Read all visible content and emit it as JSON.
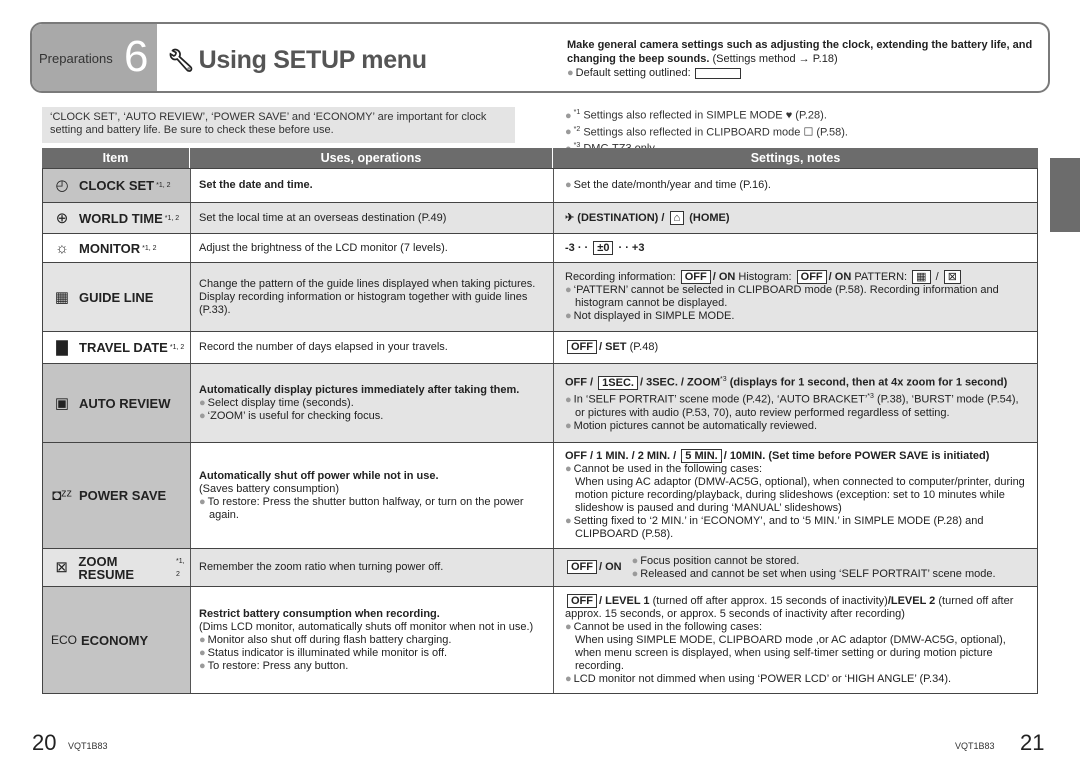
{
  "header": {
    "section": "Preparations",
    "chapter": "6",
    "title": "Using SETUP menu",
    "intro_bold": "Make general camera settings such as adjusting the clock, extending the battery life, and changing the beep sounds.",
    "intro_ref": "(Settings method → P.18)",
    "default_note": "Default setting outlined:"
  },
  "important": "‘CLOCK SET’, ‘AUTO REVIEW’, ‘POWER SAVE’ and ‘ECONOMY’ are important for clock setting and battery life. Be sure to check these before use.",
  "footnotes": [
    {
      "mark": "*1",
      "text": "Settings also reflected in SIMPLE MODE ♥ (P.28)."
    },
    {
      "mark": "*2",
      "text": "Settings also reflected in CLIPBOARD mode ☐ (P.58)."
    },
    {
      "mark": "*3",
      "text": "DMC-TZ3 only."
    }
  ],
  "columns": [
    "Item",
    "Uses, operations",
    "Settings, notes"
  ],
  "colors": {
    "header_bg": "#6c6c6c",
    "important_cell": "#c4c4c4",
    "shade": "#e4e4e4",
    "bullet": "#9a9a9a"
  },
  "rows": [
    {
      "name": "CLOCK SET",
      "sup": "*1, 2",
      "icon": "clock-icon",
      "glyph": "◴",
      "important": true,
      "shade": false,
      "uses": [
        {
          "text": "Set the date and time.",
          "bold": true
        }
      ],
      "notes": [
        {
          "bullet": true,
          "segs": [
            {
              "t": "Set the date/month/year and time (P.16)."
            }
          ]
        }
      ]
    },
    {
      "name": "WORLD TIME",
      "sup": "*1, 2",
      "icon": "globe-icon",
      "glyph": "⊕",
      "important": false,
      "shade": true,
      "uses": [
        {
          "text": "Set the local time at an overseas destination (P.49)"
        }
      ],
      "notes": [
        {
          "segs": [
            {
              "t": "✈",
              "b": true
            },
            {
              "t": " (DESTINATION) / ",
              "b": true
            },
            {
              "t": "⌂",
              "box": true
            },
            {
              "t": " (HOME)",
              "b": true
            }
          ]
        }
      ]
    },
    {
      "name": "MONITOR",
      "sup": "*1, 2",
      "icon": "brightness-icon",
      "glyph": "☼",
      "important": false,
      "shade": false,
      "uses": [
        {
          "text": "Adjust the brightness of the LCD monitor (7 levels)."
        }
      ],
      "notes": [
        {
          "segs": [
            {
              "t": "-3  ·  · ",
              "b": true
            },
            {
              "t": "±0",
              "box": true,
              "b": true
            },
            {
              "t": " ·  ·  +3",
              "b": true
            }
          ]
        }
      ]
    },
    {
      "name": "GUIDE LINE",
      "sup": "",
      "icon": "grid-icon",
      "glyph": "▦",
      "important": false,
      "shade": true,
      "uses": [
        {
          "text": "Change the pattern of the guide lines displayed when taking pictures."
        },
        {
          "text": "Display recording information or histogram together with guide lines (P.33)."
        }
      ],
      "notes": [
        {
          "segs": [
            {
              "t": "Recording information: "
            },
            {
              "t": "OFF",
              "box": true,
              "b": true
            },
            {
              "t": "/ ON",
              "b": true
            },
            {
              "t": "   Histogram: "
            },
            {
              "t": "OFF",
              "box": true,
              "b": true
            },
            {
              "t": "/ ON",
              "b": true
            },
            {
              "t": "   PATTERN: "
            },
            {
              "t": "▦",
              "box": true
            },
            {
              "t": " / "
            },
            {
              "t": "⊠",
              "box": true
            }
          ]
        },
        {
          "bullet": true,
          "segs": [
            {
              "t": "‘PATTERN’ cannot be selected in CLIPBOARD mode (P.58). Recording information and histogram cannot be displayed."
            }
          ]
        },
        {
          "bullet": true,
          "segs": [
            {
              "t": "Not displayed in SIMPLE MODE."
            }
          ]
        }
      ]
    },
    {
      "name": "TRAVEL DATE",
      "sup": "*1, 2",
      "icon": "suitcase-icon",
      "glyph": "▇",
      "important": false,
      "shade": false,
      "uses": [
        {
          "text": "Record the number of days elapsed in your travels."
        }
      ],
      "notes": [
        {
          "segs": [
            {
              "t": "OFF",
              "box": true,
              "b": true
            },
            {
              "t": "/ SET",
              "b": true
            },
            {
              "t": " (P.48)"
            }
          ]
        }
      ]
    },
    {
      "name": "AUTO REVIEW",
      "sup": "",
      "icon": "auto-review-icon",
      "glyph": "▣",
      "important": true,
      "shade": true,
      "uses": [
        {
          "text": "Automatically display pictures immediately after taking them.",
          "bold": true
        },
        {
          "text": "Select display time (seconds).",
          "bullet": true
        },
        {
          "text": "‘ZOOM’ is useful for checking focus.",
          "bullet": true
        }
      ],
      "notes": [
        {
          "segs": [
            {
              "t": "OFF / ",
              "b": true
            },
            {
              "t": "1SEC.",
              "box": true,
              "b": true
            },
            {
              "t": "/ 3SEC. / ZOOM",
              "b": true
            },
            {
              "t": "*3",
              "sup": true
            },
            {
              "t": " (displays for 1 second, then at 4x zoom for 1 second)",
              "b": true
            }
          ]
        },
        {
          "bullet": true,
          "segs": [
            {
              "t": "In ‘SELF PORTRAIT’ scene mode (P.42), ‘AUTO BRACKET’"
            },
            {
              "t": "*3",
              "sup": true
            },
            {
              "t": " (P.38), ‘BURST’ mode (P.54), or pictures with audio (P.53, 70), auto review performed regardless of setting."
            }
          ]
        },
        {
          "bullet": true,
          "segs": [
            {
              "t": "Motion pictures cannot be automatically reviewed."
            }
          ]
        }
      ]
    },
    {
      "name": "POWER SAVE",
      "sup": "",
      "icon": "power-save-icon",
      "glyph": "◘ᶻᶻ",
      "important": true,
      "shade": false,
      "uses": [
        {
          "text": "Automatically shut off power while not in use.",
          "bold": true
        },
        {
          "text": "(Saves battery consumption)"
        },
        {
          "text": "To restore: Press the shutter button halfway, or turn on the power again.",
          "bullet": true
        }
      ],
      "notes": [
        {
          "segs": [
            {
              "t": "OFF / 1 MIN. / 2 MIN. / ",
              "b": true
            },
            {
              "t": "5 MIN.",
              "box": true,
              "b": true
            },
            {
              "t": "/ 10MIN. (Set time before POWER SAVE is initiated)",
              "b": true
            }
          ]
        },
        {
          "bullet": true,
          "segs": [
            {
              "t": "Cannot be used in the following cases:"
            }
          ]
        },
        {
          "indent": true,
          "segs": [
            {
              "t": "When using AC adaptor (DMW-AC5G, optional), when connected to computer/printer, during motion picture recording/playback, during slideshows (exception: set to 10 minutes while slideshow is paused and during ‘MANUAL’ slideshows)"
            }
          ]
        },
        {
          "bullet": true,
          "segs": [
            {
              "t": "Setting fixed to ‘2 MIN.’ in ‘ECONOMY’, and to ‘5 MIN.’ in SIMPLE MODE (P.28) and CLIPBOARD (P.58)."
            }
          ]
        }
      ]
    },
    {
      "name": "ZOOM RESUME",
      "sup": "*1, 2",
      "icon": "zoom-resume-icon",
      "glyph": "⊠",
      "important": false,
      "shade": true,
      "inline": true,
      "uses": [
        {
          "text": "Remember the zoom ratio when turning power off."
        }
      ],
      "notes": [
        {
          "segs": [
            {
              "t": "OFF",
              "box": true,
              "b": true
            },
            {
              "t": "/ ON",
              "b": true
            }
          ]
        },
        {
          "bullet": true,
          "segs": [
            {
              "t": "Focus position cannot be stored."
            }
          ]
        },
        {
          "bullet": true,
          "segs": [
            {
              "t": "Released and cannot be set when using ‘SELF PORTRAIT’ scene mode."
            }
          ]
        }
      ]
    },
    {
      "name": "ECONOMY",
      "sup": "",
      "icon": "eco-icon",
      "glyph": "ECO",
      "important": true,
      "shade": false,
      "uses": [
        {
          "text": "Restrict battery consumption when recording.",
          "bold": true
        },
        {
          "text": "(Dims LCD monitor, automatically shuts off monitor when not in use.)"
        },
        {
          "text": "Monitor also shut off during flash battery charging.",
          "bullet": true
        },
        {
          "text": "Status indicator is illuminated while monitor is off.",
          "bullet": true
        },
        {
          "text": "To restore: Press any button.",
          "bullet": true
        }
      ],
      "notes": [
        {
          "segs": [
            {
              "t": "OFF",
              "box": true,
              "b": true
            },
            {
              "t": "/ LEVEL 1",
              "b": true
            },
            {
              "t": " (turned off after approx. 15 seconds of inactivity)"
            },
            {
              "t": "/LEVEL 2",
              "b": true
            },
            {
              "t": " (turned off after approx. 15 seconds, or approx. 5 seconds of inactivity after recording)"
            }
          ]
        },
        {
          "bullet": true,
          "segs": [
            {
              "t": "Cannot be used in the following cases:"
            }
          ]
        },
        {
          "indent": true,
          "segs": [
            {
              "t": "When using SIMPLE MODE, CLIPBOARD mode ,or AC adaptor (DMW-AC5G, optional), when menu screen is displayed, when using self-timer setting or during motion picture recording."
            }
          ]
        },
        {
          "bullet": true,
          "segs": [
            {
              "t": "LCD monitor not dimmed when using ‘POWER LCD’ or ‘HIGH ANGLE’ (P.34)."
            }
          ]
        }
      ]
    }
  ],
  "footer": {
    "left_page": "20",
    "right_page": "21",
    "code_left": "VQT1B83",
    "code_right": "VQT1B83"
  }
}
